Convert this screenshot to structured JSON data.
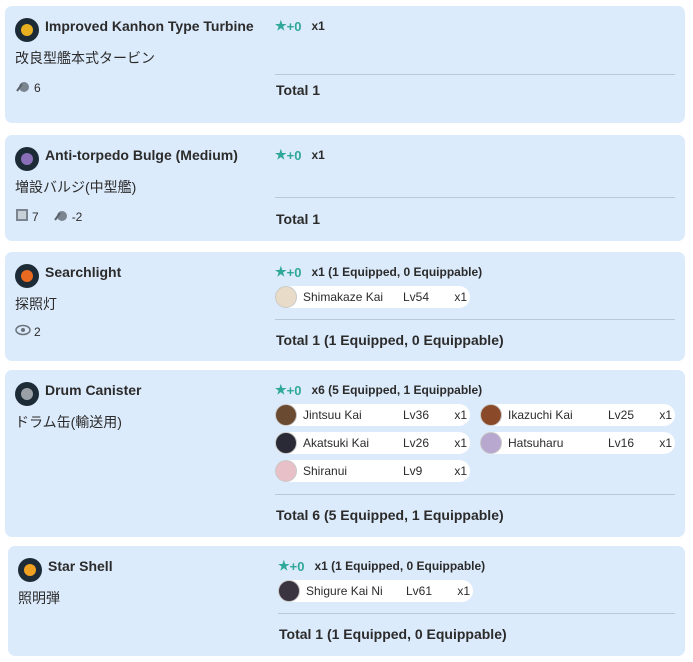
{
  "cards": [
    {
      "name": "Improved Kanhon Type Turbine",
      "jp_name": "改良型艦本式タービン",
      "stats": [
        {
          "icon": "evasion-icon",
          "value": "6"
        }
      ],
      "improvement": "+0",
      "count": "x1",
      "ships": [],
      "total": "Total 1",
      "icon_color": "#e8b020"
    },
    {
      "name": "Anti-torpedo Bulge (Medium)",
      "jp_name": "増設バルジ(中型艦)",
      "stats": [
        {
          "icon": "armor-icon",
          "value": "7"
        },
        {
          "icon": "evasion-icon",
          "value": "-2"
        }
      ],
      "improvement": "+0",
      "count": "x1",
      "ships": [],
      "total": "Total 1",
      "icon_color": "#8a6fb8"
    },
    {
      "name": "Searchlight",
      "jp_name": "探照灯",
      "stats": [
        {
          "icon": "line-of-sight-icon",
          "value": "2"
        }
      ],
      "improvement": "+0",
      "count": "x1 (1 Equipped, 0 Equippable)",
      "ships": [
        {
          "name": "Shimakaze Kai",
          "level": "Lv54",
          "count": "x1",
          "avatar": "#e8dcc8"
        }
      ],
      "total": "Total 1 (1 Equipped, 0 Equippable)",
      "icon_color": "#e86a20"
    },
    {
      "name": "Drum Canister",
      "jp_name": "ドラム缶(輸送用)",
      "stats": [],
      "improvement": "+0",
      "count": "x6 (5 Equipped, 1 Equippable)",
      "ships": [
        {
          "name": "Jintsuu Kai",
          "level": "Lv36",
          "count": "x1",
          "avatar": "#6b4a32"
        },
        {
          "name": "Ikazuchi Kai",
          "level": "Lv25",
          "count": "x1",
          "avatar": "#8a4a2a"
        },
        {
          "name": "Akatsuki Kai",
          "level": "Lv26",
          "count": "x1",
          "avatar": "#2a2a36"
        },
        {
          "name": "Hatsuharu",
          "level": "Lv16",
          "count": "x1",
          "avatar": "#b8a8d0"
        },
        {
          "name": "Shiranui",
          "level": "Lv9",
          "count": "x1",
          "avatar": "#e8c0c8"
        }
      ],
      "total": "Total 6 (5 Equipped, 1 Equippable)",
      "icon_color": "#9aa0a6"
    },
    {
      "name": "Star Shell",
      "jp_name": "照明弾",
      "stats": [],
      "improvement": "+0",
      "count": "x1 (1 Equipped, 0 Equippable)",
      "ships": [
        {
          "name": "Shigure Kai Ni",
          "level": "Lv61",
          "count": "x1",
          "avatar": "#3a3440"
        }
      ],
      "total": "Total 1 (1 Equipped, 0 Equippable)",
      "icon_color": "#f0a020"
    }
  ]
}
